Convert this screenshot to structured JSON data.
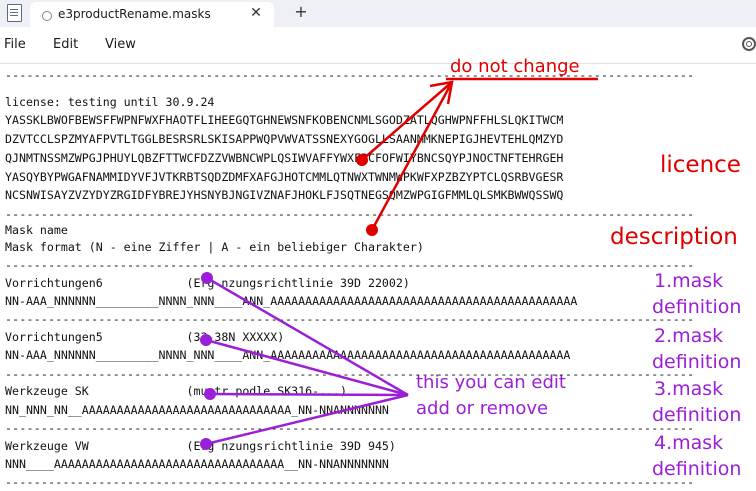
{
  "window": {
    "tab_title": "e3productRename.masks",
    "close_glyph": "✕",
    "new_tab_glyph": "+"
  },
  "menu": {
    "file": "File",
    "edit": "Edit",
    "view": "View",
    "settings_icon": "gear-icon"
  },
  "editor": {
    "lines": [
      "------------------------------------------------------------------------------------------------",
      "license: testing until 30.9.24",
      "YASSKLBWOFBEWSFFWPNFWXFHAOTFLIHEEGQTGHNEWSNFKOBENCNMLSGODZATLQGHWPNFFHLSLQKITWCM",
      "DZVTCCLSPZMYAFPVTLTGGLBESRSRLSKISAPPWQPVWVATSSNEXYGOGLLSAANMMKNEPIGJHEVTEHLQMZYD",
      "QJNMTNSSMZWPGJPHUYLQBZFTTWCFDZZVWBNCWPLQSIWVAFFYWXFRCFOFWIYBNCSQYPJNOCTNFTEHRGEH",
      "YASQYBYPWGAFNAMMIDYVFJVTKRBTSQDZDMFXAFGJHOTCMMLQTNWXTWNMWPKWFXPZBZYPTCLQSRBVGESR",
      "NCSNWISAYZVZYDYZRGIDFYBREJYHSNYBJNGIVZNAFJHOKLFJSQTNEGSQMZWPGIGFMMLQLSMKBWWQSSWQ",
      "------------------------------------------------------------------------------------------------",
      "Mask name",
      "Mask format (N - eine Ziffer | A - ein beliebiger Charakter)",
      "------------------------------------------------------------------------------------------------",
      "Vorrichtungen6            (Erg nzungsrichtlinie 39D 22002)",
      "NN-AAA_NNNNNN_________NNNN_NNN____ANN_AAAAAAAAAAAAAAAAAAAAAAAAAAAAAAAAAAAAAAAAAAAA",
      "------------------------------------------------------------------------------------------------",
      "Vorrichtungen5            (33-38N XXXXX)",
      "NN-AAA_NNNNNN_________NNNN_NNN____ANN_AAAAAAAAAAAAAAAAAAAAAAAAAAAAAAAAAAAAAAAAAAA",
      "------------------------------------------------------------------------------------------------",
      "Werkzeuge SK              (mustr podle SK316-...)",
      "NN_NNN_NN__AAAAAAAAAAAAAAAAAAAAAAAAAAAAAA_NN-NNANNNNNNN",
      "------------------------------------------------------------------------------------------------",
      "Werkzeuge VW              (Erg nzungsrichtlinie 39D 945)",
      "NNN____AAAAAAAAAAAAAAAAAAAAAAAAAAAAAAAAA__NN-NNANNNNNNN",
      "------------------------------------------------------------------------------------------------"
    ]
  },
  "annotations": {
    "do_not_change": "do not change",
    "licence": "licence",
    "description": "description",
    "edit_note_1": "this you can edit",
    "edit_note_2": "add or remove",
    "mask1_a": "1.mask",
    "mask2_a": "2.mask",
    "mask3_a": "3.mask",
    "mask4_a": "4.mask",
    "definition": "definition",
    "red_color": "#e00000",
    "purple_color": "#9b1fd6"
  }
}
